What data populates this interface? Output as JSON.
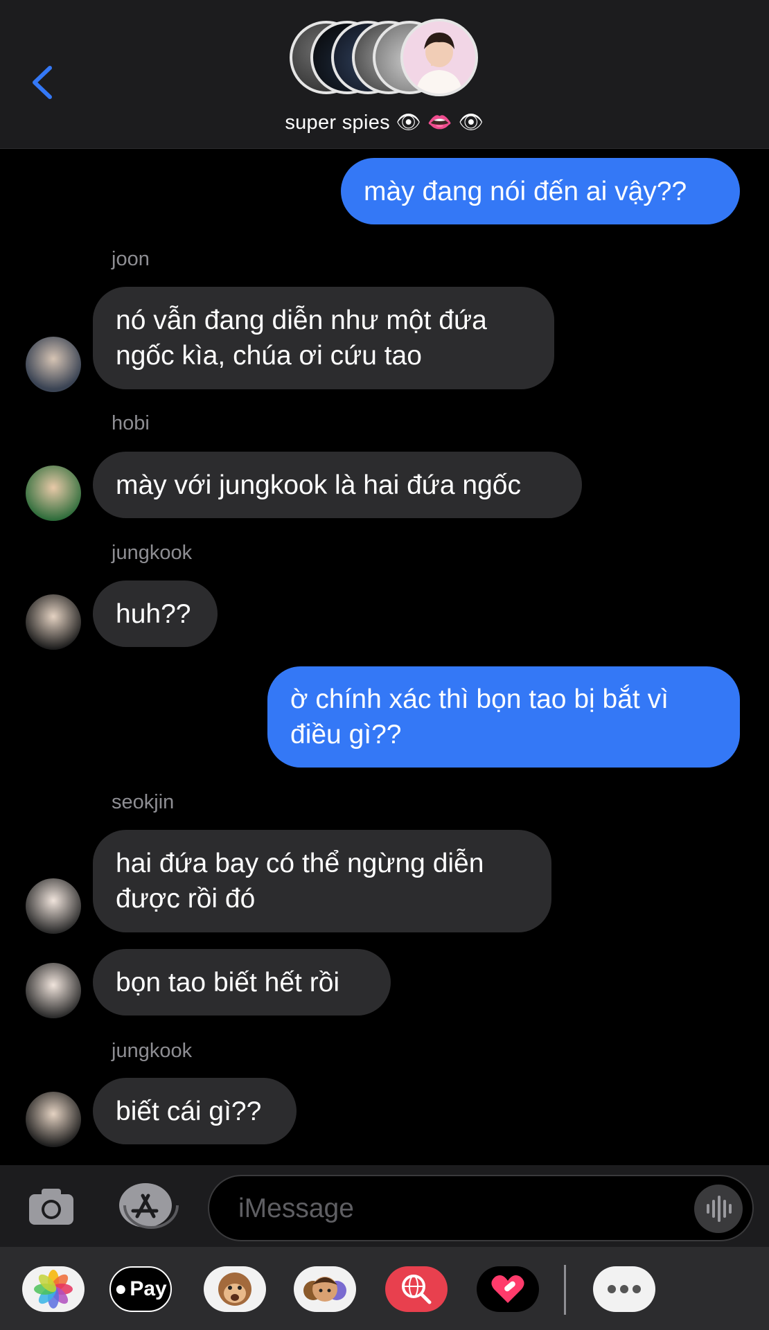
{
  "header": {
    "group_name": "super spies",
    "group_name_emoji": "👁 👄 👁",
    "back_icon": "chevron-left-icon"
  },
  "messages": [
    {
      "type": "sent",
      "text": "mày đang nói đến ai vậy??"
    },
    {
      "type": "received",
      "sender": "joon",
      "text": "nó vẫn đang diễn như một đứa ngốc kìa, chúa ơi cứu tao"
    },
    {
      "type": "received",
      "sender": "hobi",
      "text": "mày với jungkook là hai đứa ngốc"
    },
    {
      "type": "received",
      "sender": "jungkook",
      "text": "huh??"
    },
    {
      "type": "sent",
      "text": "ờ chính xác thì bọn tao bị bắt vì điều gì??"
    },
    {
      "type": "received",
      "sender": "seokjin",
      "text": "hai đứa bay có thể ngừng diễn được rồi đó"
    },
    {
      "type": "received",
      "sender": "seokjin",
      "text": "bọn tao biết hết rồi"
    },
    {
      "type": "received",
      "sender": "jungkook",
      "text": "biết cái gì??"
    }
  ],
  "composer": {
    "placeholder": "iMessage",
    "camera_icon": "camera-icon",
    "apps_icon": "app-store-icon",
    "audio_icon": "waveform-icon"
  },
  "drawer": {
    "apps": [
      "photos-icon",
      "apple-pay-icon",
      "animoji-icon",
      "memoji-icon",
      "web-search-icon",
      "digital-touch-icon",
      "more-icon"
    ],
    "apple_pay_label": "Pay"
  },
  "colors": {
    "sent_bubble": "#3478f6",
    "received_bubble": "#2c2c2e",
    "background": "#000000",
    "bars": "#1c1c1e"
  }
}
